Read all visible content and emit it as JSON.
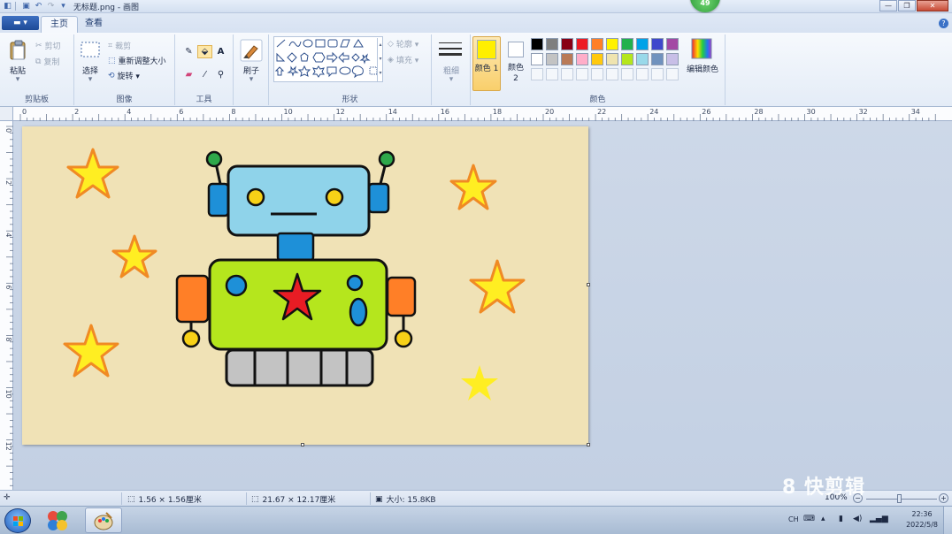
{
  "window": {
    "title": "无标题.png - 画图",
    "badge": "49"
  },
  "menu_button": "▬ ▾",
  "tabs": [
    {
      "label": "主页",
      "active": true
    },
    {
      "label": "查看",
      "active": false
    }
  ],
  "ribbon": {
    "clipboard": {
      "paste": "粘贴",
      "cut": "剪切",
      "copy": "复制",
      "label": "剪贴板"
    },
    "image": {
      "select": "选择",
      "crop": "裁剪",
      "resize": "重新调整大小",
      "rotate": "旋转 ▾",
      "label": "图像"
    },
    "tools": {
      "label": "工具"
    },
    "brushes": {
      "label": "刷子"
    },
    "shapes": {
      "outline": "轮廓 ▾",
      "fill": "填充 ▾",
      "label": "形状"
    },
    "size": {
      "label": "粗细"
    },
    "colors": {
      "color1": "颜色 1",
      "color2": "颜色 2",
      "edit": "编辑颜色",
      "label": "颜色",
      "color1_value": "#FFEF00",
      "color2_value": "#FFFFFF",
      "palette_row1": [
        "#000000",
        "#7f7f7f",
        "#880015",
        "#ed1c24",
        "#ff7f27",
        "#fff200",
        "#22b14c",
        "#00a2e8",
        "#3f48cc",
        "#a349a4"
      ],
      "palette_row2": [
        "#ffffff",
        "#c3c3c3",
        "#b97a57",
        "#ffaec9",
        "#ffc90e",
        "#efe4b0",
        "#b5e61d",
        "#99d9ea",
        "#7092be",
        "#c8bfe7"
      ]
    }
  },
  "ruler": {
    "h_labels": [
      "0",
      "2",
      "4",
      "6",
      "8",
      "10",
      "12",
      "14",
      "16",
      "18",
      "20",
      "22",
      "24",
      "26",
      "28",
      "30",
      "32",
      "34"
    ],
    "v_labels": [
      "0",
      "2",
      "4",
      "6",
      "8",
      "10",
      "12"
    ]
  },
  "canvas": {
    "background": "#F0E2B6"
  },
  "status": {
    "selection_size": "1.56 × 1.56厘米",
    "image_size": "21.67 × 12.17厘米",
    "file_size": "大小: 15.8KB",
    "zoom": "100%"
  },
  "watermark": "8 快剪辑",
  "taskbar": {
    "time": "22:36",
    "date": "2022/5/8",
    "lang": "CH"
  }
}
